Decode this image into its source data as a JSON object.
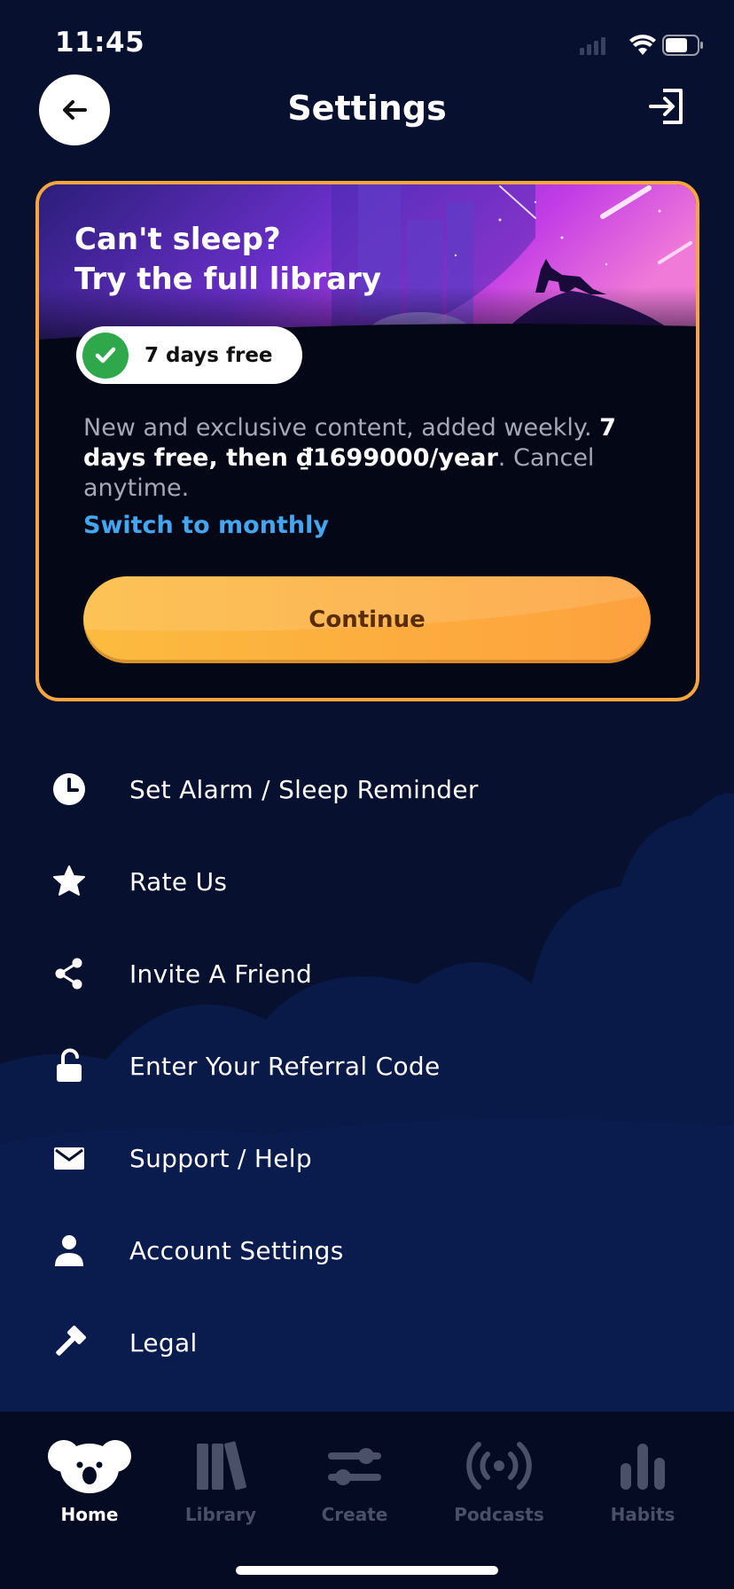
{
  "status_bar": {
    "time": "11:45"
  },
  "header": {
    "title": "Settings"
  },
  "promo": {
    "title_line1": "Can't sleep?",
    "title_line2": "Try the full library",
    "trial_badge": "7 days free",
    "description_lead": "New and exclusive content, added weekly.",
    "description_bold": "7 days free, then ₫1699000/year",
    "description_tail": ". Cancel anytime.",
    "switch_link": "Switch to monthly",
    "continue_label": "Continue"
  },
  "settings": {
    "items": [
      {
        "label": "Set Alarm / Sleep Reminder",
        "icon": "clock-icon"
      },
      {
        "label": "Rate Us",
        "icon": "star-icon"
      },
      {
        "label": "Invite A Friend",
        "icon": "share-icon"
      },
      {
        "label": "Enter Your Referral Code",
        "icon": "unlock-icon"
      },
      {
        "label": "Support / Help",
        "icon": "mail-icon"
      },
      {
        "label": "Account Settings",
        "icon": "person-icon"
      },
      {
        "label": "Legal",
        "icon": "gavel-icon"
      }
    ]
  },
  "tabs": [
    {
      "label": "Home",
      "icon": "koala-icon",
      "active": true
    },
    {
      "label": "Library",
      "icon": "books-icon",
      "active": false
    },
    {
      "label": "Create",
      "icon": "sliders-icon",
      "active": false
    },
    {
      "label": "Podcasts",
      "icon": "broadcast-icon",
      "active": false
    },
    {
      "label": "Habits",
      "icon": "bar-chart-icon",
      "active": false
    }
  ],
  "colors": {
    "background": "#07102e",
    "card_border": "#f6a63c",
    "link": "#43a6f0",
    "button_start": "#fcbb3f",
    "button_end": "#fda13e",
    "tab_inactive": "#4a5068"
  }
}
